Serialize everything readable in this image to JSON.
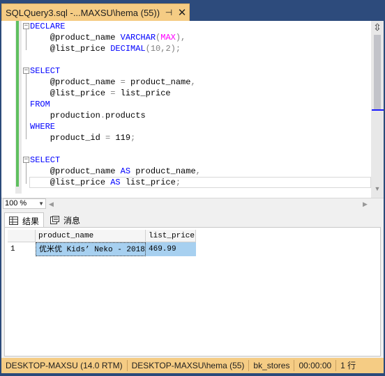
{
  "tab": {
    "title": "SQLQuery3.sql -...MAXSU\\hema (55))",
    "pin_glyph": "⊣",
    "close_glyph": "✕"
  },
  "editor": {
    "lines": [
      {
        "parts": [
          {
            "t": "DECLARE",
            "c": "kw"
          }
        ]
      },
      {
        "parts": [
          {
            "t": "    @product_name ",
            "c": ""
          },
          {
            "t": "VARCHAR",
            "c": "kw"
          },
          {
            "t": "(",
            "c": "gray"
          },
          {
            "t": "MAX",
            "c": "fn"
          },
          {
            "t": "),",
            "c": "gray"
          }
        ]
      },
      {
        "parts": [
          {
            "t": "    @list_price ",
            "c": ""
          },
          {
            "t": "DECIMAL",
            "c": "kw"
          },
          {
            "t": "(10,2);",
            "c": "gray"
          }
        ]
      },
      {
        "parts": [
          {
            "t": "",
            "c": ""
          }
        ]
      },
      {
        "parts": [
          {
            "t": "SELECT",
            "c": "kw"
          }
        ]
      },
      {
        "parts": [
          {
            "t": "    @product_name ",
            "c": ""
          },
          {
            "t": "=",
            "c": "gray"
          },
          {
            "t": " product_name",
            "c": ""
          },
          {
            "t": ",",
            "c": "gray"
          }
        ]
      },
      {
        "parts": [
          {
            "t": "    @list_price ",
            "c": ""
          },
          {
            "t": "=",
            "c": "gray"
          },
          {
            "t": " list_price",
            "c": ""
          }
        ]
      },
      {
        "parts": [
          {
            "t": "FROM",
            "c": "kw"
          }
        ]
      },
      {
        "parts": [
          {
            "t": "    production",
            "c": ""
          },
          {
            "t": ".",
            "c": "gray"
          },
          {
            "t": "products",
            "c": ""
          }
        ]
      },
      {
        "parts": [
          {
            "t": "WHERE",
            "c": "kw"
          }
        ]
      },
      {
        "parts": [
          {
            "t": "    product_id ",
            "c": ""
          },
          {
            "t": "=",
            "c": "gray"
          },
          {
            "t": " 119",
            "c": ""
          },
          {
            "t": ";",
            "c": "gray"
          }
        ]
      },
      {
        "parts": [
          {
            "t": "",
            "c": ""
          }
        ]
      },
      {
        "parts": [
          {
            "t": "SELECT",
            "c": "kw"
          }
        ]
      },
      {
        "parts": [
          {
            "t": "    @product_name ",
            "c": ""
          },
          {
            "t": "AS",
            "c": "kw"
          },
          {
            "t": " product_name",
            "c": ""
          },
          {
            "t": ",",
            "c": "gray"
          }
        ]
      },
      {
        "parts": [
          {
            "t": "    @list_price ",
            "c": ""
          },
          {
            "t": "AS",
            "c": "kw"
          },
          {
            "t": " list_price",
            "c": ""
          },
          {
            "t": ";",
            "c": "gray"
          }
        ]
      }
    ],
    "fold_glyph": "−"
  },
  "zoom": {
    "value": "100 %"
  },
  "results": {
    "tabs": [
      {
        "label": "结果",
        "icon": "grid-icon"
      },
      {
        "label": "消息",
        "icon": "message-icon"
      }
    ],
    "columns": [
      "product_name",
      "list_price"
    ],
    "rows": [
      {
        "num": "1",
        "cells": [
          "优米优 Kids’ Neko - 2018",
          "469.99"
        ]
      }
    ]
  },
  "status": {
    "server": "DESKTOP-MAXSU (14.0 RTM)",
    "login": "DESKTOP-MAXSU\\hema (55)",
    "database": "bk_stores",
    "elapsed": "00:00:00",
    "rows": "1 行"
  },
  "colors": {
    "accent": "#f5cc84",
    "keyword": "#0000ff",
    "function": "#ff00ff",
    "selection": "#a7d0f0"
  }
}
